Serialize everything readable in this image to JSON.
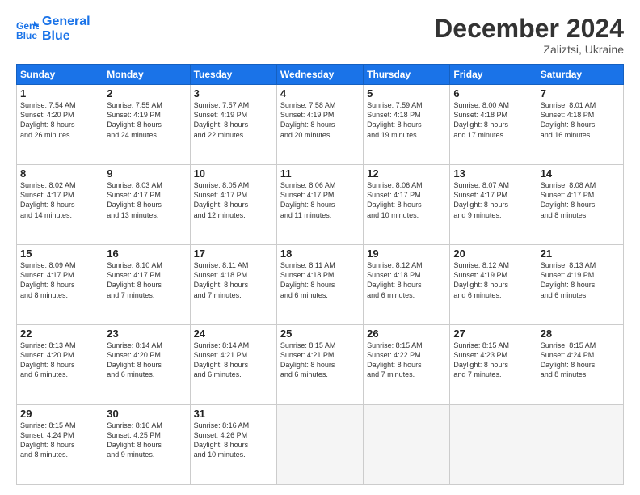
{
  "header": {
    "logo_line1": "General",
    "logo_line2": "Blue",
    "month": "December 2024",
    "location": "Zaliztsi, Ukraine"
  },
  "weekdays": [
    "Sunday",
    "Monday",
    "Tuesday",
    "Wednesday",
    "Thursday",
    "Friday",
    "Saturday"
  ],
  "weeks": [
    [
      {
        "day": "1",
        "lines": [
          "Sunrise: 7:54 AM",
          "Sunset: 4:20 PM",
          "Daylight: 8 hours",
          "and 26 minutes."
        ]
      },
      {
        "day": "2",
        "lines": [
          "Sunrise: 7:55 AM",
          "Sunset: 4:19 PM",
          "Daylight: 8 hours",
          "and 24 minutes."
        ]
      },
      {
        "day": "3",
        "lines": [
          "Sunrise: 7:57 AM",
          "Sunset: 4:19 PM",
          "Daylight: 8 hours",
          "and 22 minutes."
        ]
      },
      {
        "day": "4",
        "lines": [
          "Sunrise: 7:58 AM",
          "Sunset: 4:19 PM",
          "Daylight: 8 hours",
          "and 20 minutes."
        ]
      },
      {
        "day": "5",
        "lines": [
          "Sunrise: 7:59 AM",
          "Sunset: 4:18 PM",
          "Daylight: 8 hours",
          "and 19 minutes."
        ]
      },
      {
        "day": "6",
        "lines": [
          "Sunrise: 8:00 AM",
          "Sunset: 4:18 PM",
          "Daylight: 8 hours",
          "and 17 minutes."
        ]
      },
      {
        "day": "7",
        "lines": [
          "Sunrise: 8:01 AM",
          "Sunset: 4:18 PM",
          "Daylight: 8 hours",
          "and 16 minutes."
        ]
      }
    ],
    [
      {
        "day": "8",
        "lines": [
          "Sunrise: 8:02 AM",
          "Sunset: 4:17 PM",
          "Daylight: 8 hours",
          "and 14 minutes."
        ]
      },
      {
        "day": "9",
        "lines": [
          "Sunrise: 8:03 AM",
          "Sunset: 4:17 PM",
          "Daylight: 8 hours",
          "and 13 minutes."
        ]
      },
      {
        "day": "10",
        "lines": [
          "Sunrise: 8:05 AM",
          "Sunset: 4:17 PM",
          "Daylight: 8 hours",
          "and 12 minutes."
        ]
      },
      {
        "day": "11",
        "lines": [
          "Sunrise: 8:06 AM",
          "Sunset: 4:17 PM",
          "Daylight: 8 hours",
          "and 11 minutes."
        ]
      },
      {
        "day": "12",
        "lines": [
          "Sunrise: 8:06 AM",
          "Sunset: 4:17 PM",
          "Daylight: 8 hours",
          "and 10 minutes."
        ]
      },
      {
        "day": "13",
        "lines": [
          "Sunrise: 8:07 AM",
          "Sunset: 4:17 PM",
          "Daylight: 8 hours",
          "and 9 minutes."
        ]
      },
      {
        "day": "14",
        "lines": [
          "Sunrise: 8:08 AM",
          "Sunset: 4:17 PM",
          "Daylight: 8 hours",
          "and 8 minutes."
        ]
      }
    ],
    [
      {
        "day": "15",
        "lines": [
          "Sunrise: 8:09 AM",
          "Sunset: 4:17 PM",
          "Daylight: 8 hours",
          "and 8 minutes."
        ]
      },
      {
        "day": "16",
        "lines": [
          "Sunrise: 8:10 AM",
          "Sunset: 4:17 PM",
          "Daylight: 8 hours",
          "and 7 minutes."
        ]
      },
      {
        "day": "17",
        "lines": [
          "Sunrise: 8:11 AM",
          "Sunset: 4:18 PM",
          "Daylight: 8 hours",
          "and 7 minutes."
        ]
      },
      {
        "day": "18",
        "lines": [
          "Sunrise: 8:11 AM",
          "Sunset: 4:18 PM",
          "Daylight: 8 hours",
          "and 6 minutes."
        ]
      },
      {
        "day": "19",
        "lines": [
          "Sunrise: 8:12 AM",
          "Sunset: 4:18 PM",
          "Daylight: 8 hours",
          "and 6 minutes."
        ]
      },
      {
        "day": "20",
        "lines": [
          "Sunrise: 8:12 AM",
          "Sunset: 4:19 PM",
          "Daylight: 8 hours",
          "and 6 minutes."
        ]
      },
      {
        "day": "21",
        "lines": [
          "Sunrise: 8:13 AM",
          "Sunset: 4:19 PM",
          "Daylight: 8 hours",
          "and 6 minutes."
        ]
      }
    ],
    [
      {
        "day": "22",
        "lines": [
          "Sunrise: 8:13 AM",
          "Sunset: 4:20 PM",
          "Daylight: 8 hours",
          "and 6 minutes."
        ]
      },
      {
        "day": "23",
        "lines": [
          "Sunrise: 8:14 AM",
          "Sunset: 4:20 PM",
          "Daylight: 8 hours",
          "and 6 minutes."
        ]
      },
      {
        "day": "24",
        "lines": [
          "Sunrise: 8:14 AM",
          "Sunset: 4:21 PM",
          "Daylight: 8 hours",
          "and 6 minutes."
        ]
      },
      {
        "day": "25",
        "lines": [
          "Sunrise: 8:15 AM",
          "Sunset: 4:21 PM",
          "Daylight: 8 hours",
          "and 6 minutes."
        ]
      },
      {
        "day": "26",
        "lines": [
          "Sunrise: 8:15 AM",
          "Sunset: 4:22 PM",
          "Daylight: 8 hours",
          "and 7 minutes."
        ]
      },
      {
        "day": "27",
        "lines": [
          "Sunrise: 8:15 AM",
          "Sunset: 4:23 PM",
          "Daylight: 8 hours",
          "and 7 minutes."
        ]
      },
      {
        "day": "28",
        "lines": [
          "Sunrise: 8:15 AM",
          "Sunset: 4:24 PM",
          "Daylight: 8 hours",
          "and 8 minutes."
        ]
      }
    ],
    [
      {
        "day": "29",
        "lines": [
          "Sunrise: 8:15 AM",
          "Sunset: 4:24 PM",
          "Daylight: 8 hours",
          "and 8 minutes."
        ]
      },
      {
        "day": "30",
        "lines": [
          "Sunrise: 8:16 AM",
          "Sunset: 4:25 PM",
          "Daylight: 8 hours",
          "and 9 minutes."
        ]
      },
      {
        "day": "31",
        "lines": [
          "Sunrise: 8:16 AM",
          "Sunset: 4:26 PM",
          "Daylight: 8 hours",
          "and 10 minutes."
        ]
      },
      null,
      null,
      null,
      null
    ]
  ]
}
